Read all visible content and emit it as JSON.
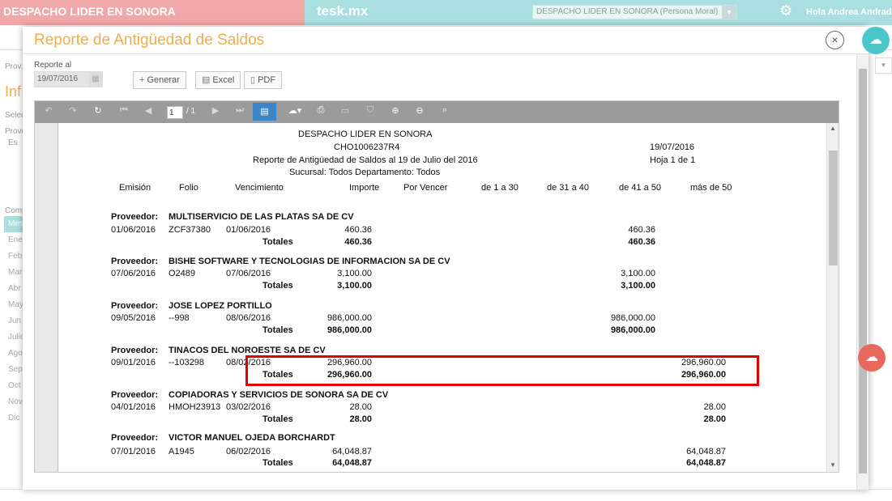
{
  "topbar": {
    "company": "DESPACHO LIDER EN SONORA",
    "brand": "tesk.mx",
    "company_select": "DESPACHO LIDER EN SONORA (Persona Moral)",
    "user": "Hola Andrea Andrade"
  },
  "background": {
    "labels": [
      "Prov",
      "Inf",
      "Selec",
      "Prove",
      "Es",
      "Comp"
    ],
    "months": [
      "Mes",
      "Ene",
      "Feb",
      "Mar",
      "Abr",
      "May",
      "Jun",
      "Julio",
      "Ago",
      "Sep",
      "Oct",
      "Nov",
      "Dic"
    ]
  },
  "modal": {
    "title": "Reporte de Antigüedad de Saldos",
    "close_icon": "×",
    "reporte_label": "Reporte al",
    "date_value": "19/07/2016",
    "buttons": {
      "generar": "Generar",
      "excel": "Excel",
      "pdf": "PDF"
    }
  },
  "viewer": {
    "page_current": "1",
    "page_total": "/ 1"
  },
  "report": {
    "company": "DESPACHO LIDER EN SONORA",
    "rfc": "CHO1006237R4",
    "date": "19/07/2016",
    "title": "Reporte de Antigüedad de Saldos al 19 de Julio del 2016",
    "page": "Hoja 1 de 1",
    "branch": "Sucursal: Todos Departamento: Todos",
    "columns": [
      "Emisión",
      "Folio",
      "Vencimiento",
      "Importe",
      "Por Vencer",
      "de 1 a 30",
      "de 31 a 40",
      "de 41 a 50",
      "más de 50"
    ],
    "proveedor_label": "Proveedor:",
    "totales_label": "Totales",
    "groups": [
      {
        "name": "MULTISERVICIO DE LAS PLATAS SA DE CV",
        "emision": "01/06/2016",
        "folio": "ZCF37380",
        "vencimiento": "01/06/2016",
        "importe": "460.36",
        "bucket": "460.36",
        "total_importe": "460.36",
        "total_bucket": "460.36"
      },
      {
        "name": "BISHE SOFTWARE Y TECNOLOGIAS DE INFORMACION SA DE CV",
        "emision": "07/06/2016",
        "folio": "O2489",
        "vencimiento": "07/06/2016",
        "importe": "3,100.00",
        "bucket": "3,100.00",
        "total_importe": "3,100.00",
        "total_bucket": "3,100.00"
      },
      {
        "name": "JOSE LOPEZ PORTILLO",
        "emision": "09/05/2016",
        "folio": "--998",
        "vencimiento": "08/06/2016",
        "importe": "986,000.00",
        "bucket": "986,000.00",
        "total_importe": "986,000.00",
        "total_bucket": "986,000.00"
      },
      {
        "name": "TINACOS DEL NOROESTE SA DE CV",
        "emision": "09/01/2016",
        "folio": "--103298",
        "vencimiento": "08/02/2016",
        "importe": "296,960.00",
        "bucket": "296,960.00",
        "total_importe": "296,960.00",
        "total_bucket": "296,960.00"
      },
      {
        "name": "COPIADORAS Y SERVICIOS  DE SONORA SA DE CV",
        "emision": "04/01/2016",
        "folio": "HMOH23913",
        "vencimiento": "03/02/2016",
        "importe": "28.00",
        "bucket": "28.00",
        "total_importe": "28.00",
        "total_bucket": "28.00"
      },
      {
        "name": "VICTOR MANUEL  OJEDA BORCHARDT",
        "emision": "07/01/2016",
        "folio": "A1945",
        "vencimiento": "06/02/2016",
        "importe": "64,048.87",
        "bucket": "64,048.87",
        "total_importe": "64,048.87",
        "total_bucket": "64,048.87"
      }
    ]
  }
}
